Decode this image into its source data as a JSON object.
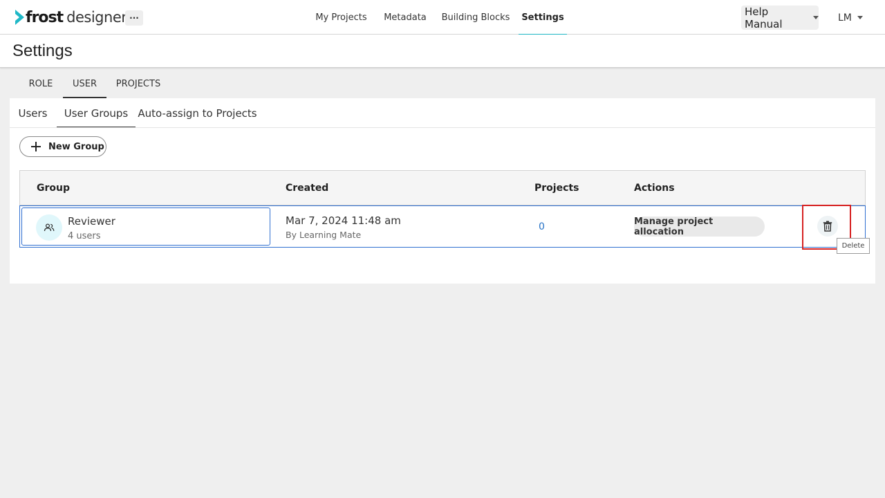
{
  "brand": {
    "word1": "frost",
    "word2": "designer",
    "accent": "#1fb8c7"
  },
  "header": {
    "more_label": "···",
    "nav": [
      {
        "label": "My Projects"
      },
      {
        "label": "Metadata"
      },
      {
        "label": "Building Blocks"
      },
      {
        "label": "Settings"
      }
    ],
    "help_label": "Help Manual",
    "user_initials": "LM"
  },
  "page": {
    "title": "Settings"
  },
  "tabs": [
    {
      "label": "ROLE"
    },
    {
      "label": "USER"
    },
    {
      "label": "PROJECTS"
    }
  ],
  "subtabs": [
    {
      "label": "Users"
    },
    {
      "label": "User Groups"
    },
    {
      "label": "Auto-assign to Projects"
    }
  ],
  "new_group_label": "New Group",
  "table": {
    "headers": [
      "Group",
      "Created",
      "Projects",
      "Actions"
    ],
    "rows": [
      {
        "name": "Reviewer",
        "members": "4 users",
        "created": "Mar 7, 2024 11:48 am",
        "created_by": "By Learning Mate",
        "projects": "0",
        "action_label": "Manage project allocation"
      }
    ]
  },
  "tooltip": "Delete",
  "icons": {
    "logo": "chevron-right-icon",
    "group": "group-icon",
    "delete": "trash-icon",
    "add": "plus-icon"
  }
}
